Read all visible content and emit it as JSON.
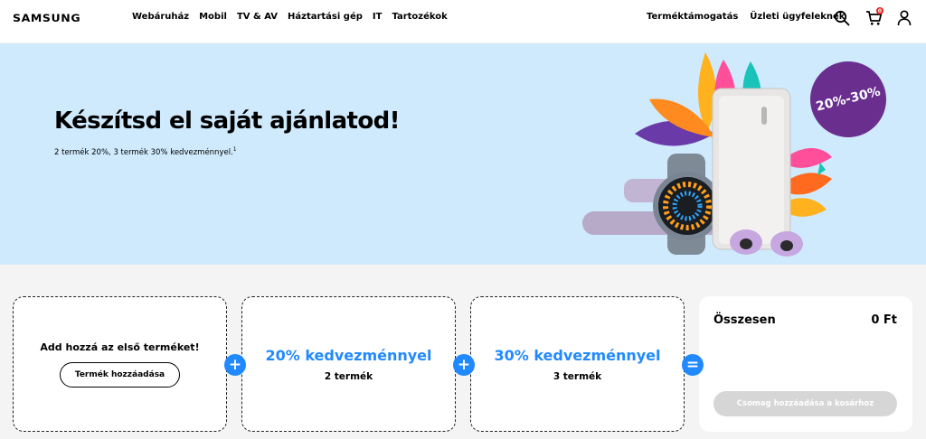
{
  "brand": {
    "logo_text": "SAMSUNG"
  },
  "nav": {
    "items": [
      "Webáruház",
      "Mobil",
      "TV & AV",
      "Háztartási gép",
      "IT",
      "Tartozékok"
    ],
    "right_items": [
      "Terméktámogatás",
      "Üzleti ügyfeleknek"
    ],
    "icons": [
      "search-icon",
      "cart-icon",
      "user-icon"
    ],
    "cart_count": "0"
  },
  "hero": {
    "title": "Készítsd el saját ajánlatod!",
    "subtitle": "2 termék 20%, 3 termék 30% kedvezménnyel.",
    "footnote": "1",
    "badge": "20%-30%"
  },
  "builder": {
    "card1": {
      "title": "Add hozzá az első terméket!",
      "button": "Termék hozzáadása"
    },
    "card2": {
      "discount": "20% kedvezménnyel",
      "count": "2 termék"
    },
    "card3": {
      "discount": "30% kedvezménnyel",
      "count": "3 termék"
    },
    "operators": [
      "+",
      "+",
      "="
    ]
  },
  "summary": {
    "label": "Összesen",
    "value": "0 Ft",
    "button": "Csomag hozzáadása a kosárhoz"
  },
  "colors": {
    "accent_blue": "#2189ff",
    "hero_bg": "#cfeafd",
    "badge_purple": "#6a2f8e",
    "page_bg": "#f4f4f4"
  }
}
